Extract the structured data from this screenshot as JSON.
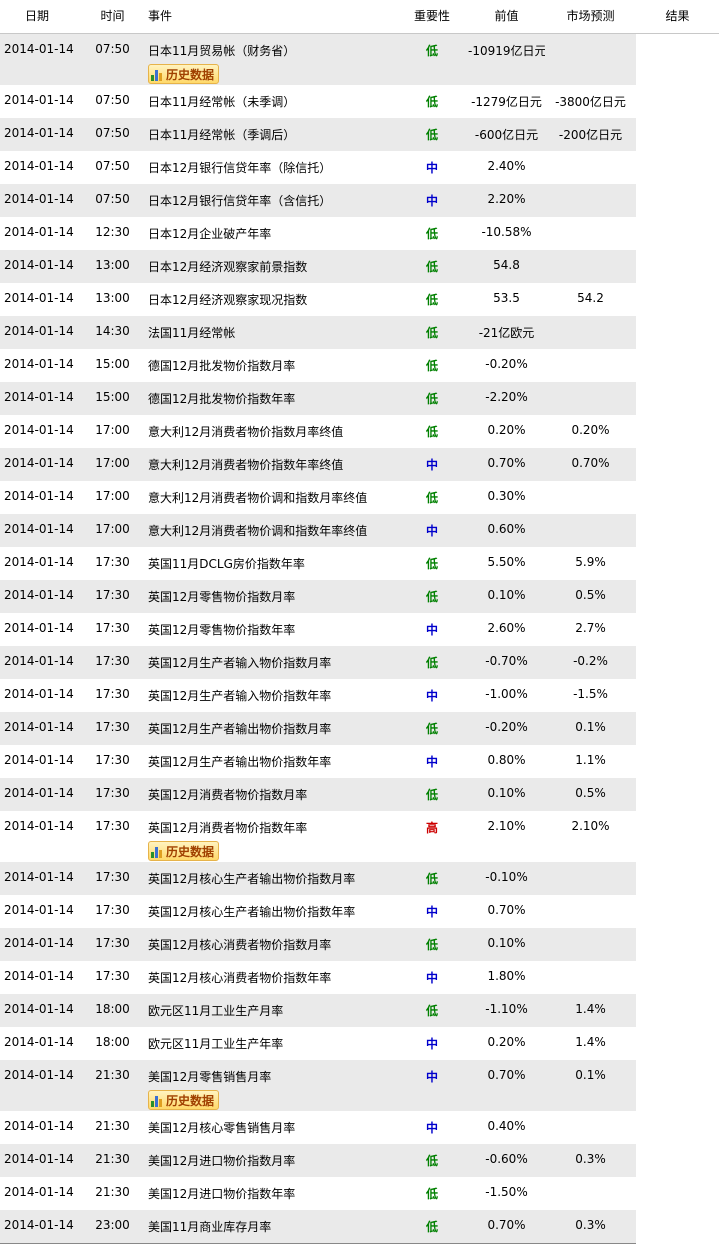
{
  "headers": {
    "date": "日期",
    "time": "时间",
    "event": "事件",
    "importance": "重要性",
    "previous": "前值",
    "forecast": "市场预测",
    "result": "结果"
  },
  "history_label": "历史数据",
  "rows": [
    {
      "date": "2014-01-14",
      "time": "07:50",
      "event": "日本11月贸易帐（财务省）",
      "importance": "低",
      "level": "low",
      "previous": "-10919亿日元",
      "forecast": "",
      "result": "",
      "history": true
    },
    {
      "date": "2014-01-14",
      "time": "07:50",
      "event": "日本11月经常帐（未季调）",
      "importance": "低",
      "level": "low",
      "previous": "-1279亿日元",
      "forecast": "-3800亿日元",
      "result": "",
      "history": false
    },
    {
      "date": "2014-01-14",
      "time": "07:50",
      "event": "日本11月经常帐（季调后）",
      "importance": "低",
      "level": "low",
      "previous": "-600亿日元",
      "forecast": "-200亿日元",
      "result": "",
      "history": false
    },
    {
      "date": "2014-01-14",
      "time": "07:50",
      "event": "日本12月银行信贷年率（除信托）",
      "importance": "中",
      "level": "mid",
      "previous": "2.40%",
      "forecast": "",
      "result": "",
      "history": false
    },
    {
      "date": "2014-01-14",
      "time": "07:50",
      "event": "日本12月银行信贷年率（含信托）",
      "importance": "中",
      "level": "mid",
      "previous": "2.20%",
      "forecast": "",
      "result": "",
      "history": false
    },
    {
      "date": "2014-01-14",
      "time": "12:30",
      "event": "日本12月企业破产年率",
      "importance": "低",
      "level": "low",
      "previous": "-10.58%",
      "forecast": "",
      "result": "",
      "history": false
    },
    {
      "date": "2014-01-14",
      "time": "13:00",
      "event": "日本12月经济观察家前景指数",
      "importance": "低",
      "level": "low",
      "previous": "54.8",
      "forecast": "",
      "result": "",
      "history": false
    },
    {
      "date": "2014-01-14",
      "time": "13:00",
      "event": "日本12月经济观察家现况指数",
      "importance": "低",
      "level": "low",
      "previous": "53.5",
      "forecast": "54.2",
      "result": "",
      "history": false
    },
    {
      "date": "2014-01-14",
      "time": "14:30",
      "event": "法国11月经常帐",
      "importance": "低",
      "level": "low",
      "previous": "-21亿欧元",
      "forecast": "",
      "result": "",
      "history": false
    },
    {
      "date": "2014-01-14",
      "time": "15:00",
      "event": "德国12月批发物价指数月率",
      "importance": "低",
      "level": "low",
      "previous": "-0.20%",
      "forecast": "",
      "result": "",
      "history": false
    },
    {
      "date": "2014-01-14",
      "time": "15:00",
      "event": "德国12月批发物价指数年率",
      "importance": "低",
      "level": "low",
      "previous": "-2.20%",
      "forecast": "",
      "result": "",
      "history": false
    },
    {
      "date": "2014-01-14",
      "time": "17:00",
      "event": "意大利12月消费者物价指数月率终值",
      "importance": "低",
      "level": "low",
      "previous": "0.20%",
      "forecast": "0.20%",
      "result": "",
      "history": false
    },
    {
      "date": "2014-01-14",
      "time": "17:00",
      "event": "意大利12月消费者物价指数年率终值",
      "importance": "中",
      "level": "mid",
      "previous": "0.70%",
      "forecast": "0.70%",
      "result": "",
      "history": false
    },
    {
      "date": "2014-01-14",
      "time": "17:00",
      "event": "意大利12月消费者物价调和指数月率终值",
      "importance": "低",
      "level": "low",
      "previous": "0.30%",
      "forecast": "",
      "result": "",
      "history": false
    },
    {
      "date": "2014-01-14",
      "time": "17:00",
      "event": "意大利12月消费者物价调和指数年率终值",
      "importance": "中",
      "level": "mid",
      "previous": "0.60%",
      "forecast": "",
      "result": "",
      "history": false
    },
    {
      "date": "2014-01-14",
      "time": "17:30",
      "event": "英国11月DCLG房价指数年率",
      "importance": "低",
      "level": "low",
      "previous": "5.50%",
      "forecast": "5.9%",
      "result": "",
      "history": false
    },
    {
      "date": "2014-01-14",
      "time": "17:30",
      "event": "英国12月零售物价指数月率",
      "importance": "低",
      "level": "low",
      "previous": "0.10%",
      "forecast": "0.5%",
      "result": "",
      "history": false
    },
    {
      "date": "2014-01-14",
      "time": "17:30",
      "event": "英国12月零售物价指数年率",
      "importance": "中",
      "level": "mid",
      "previous": "2.60%",
      "forecast": "2.7%",
      "result": "",
      "history": false
    },
    {
      "date": "2014-01-14",
      "time": "17:30",
      "event": "英国12月生产者输入物价指数月率",
      "importance": "低",
      "level": "low",
      "previous": "-0.70%",
      "forecast": "-0.2%",
      "result": "",
      "history": false
    },
    {
      "date": "2014-01-14",
      "time": "17:30",
      "event": "英国12月生产者输入物价指数年率",
      "importance": "中",
      "level": "mid",
      "previous": "-1.00%",
      "forecast": "-1.5%",
      "result": "",
      "history": false
    },
    {
      "date": "2014-01-14",
      "time": "17:30",
      "event": "英国12月生产者输出物价指数月率",
      "importance": "低",
      "level": "low",
      "previous": "-0.20%",
      "forecast": "0.1%",
      "result": "",
      "history": false
    },
    {
      "date": "2014-01-14",
      "time": "17:30",
      "event": "英国12月生产者输出物价指数年率",
      "importance": "中",
      "level": "mid",
      "previous": "0.80%",
      "forecast": "1.1%",
      "result": "",
      "history": false
    },
    {
      "date": "2014-01-14",
      "time": "17:30",
      "event": "英国12月消费者物价指数月率",
      "importance": "低",
      "level": "low",
      "previous": "0.10%",
      "forecast": "0.5%",
      "result": "",
      "history": false
    },
    {
      "date": "2014-01-14",
      "time": "17:30",
      "event": "英国12月消费者物价指数年率",
      "importance": "高",
      "level": "high",
      "previous": "2.10%",
      "forecast": "2.10%",
      "result": "",
      "history": true
    },
    {
      "date": "2014-01-14",
      "time": "17:30",
      "event": "英国12月核心生产者输出物价指数月率",
      "importance": "低",
      "level": "low",
      "previous": "-0.10%",
      "forecast": "",
      "result": "",
      "history": false
    },
    {
      "date": "2014-01-14",
      "time": "17:30",
      "event": "英国12月核心生产者输出物价指数年率",
      "importance": "中",
      "level": "mid",
      "previous": "0.70%",
      "forecast": "",
      "result": "",
      "history": false
    },
    {
      "date": "2014-01-14",
      "time": "17:30",
      "event": "英国12月核心消费者物价指数月率",
      "importance": "低",
      "level": "low",
      "previous": "0.10%",
      "forecast": "",
      "result": "",
      "history": false
    },
    {
      "date": "2014-01-14",
      "time": "17:30",
      "event": "英国12月核心消费者物价指数年率",
      "importance": "中",
      "level": "mid",
      "previous": "1.80%",
      "forecast": "",
      "result": "",
      "history": false
    },
    {
      "date": "2014-01-14",
      "time": "18:00",
      "event": "欧元区11月工业生产月率",
      "importance": "低",
      "level": "low",
      "previous": "-1.10%",
      "forecast": "1.4%",
      "result": "",
      "history": false
    },
    {
      "date": "2014-01-14",
      "time": "18:00",
      "event": "欧元区11月工业生产年率",
      "importance": "中",
      "level": "mid",
      "previous": "0.20%",
      "forecast": "1.4%",
      "result": "",
      "history": false
    },
    {
      "date": "2014-01-14",
      "time": "21:30",
      "event": "美国12月零售销售月率",
      "importance": "中",
      "level": "mid",
      "previous": "0.70%",
      "forecast": "0.1%",
      "result": "",
      "history": true
    },
    {
      "date": "2014-01-14",
      "time": "21:30",
      "event": "美国12月核心零售销售月率",
      "importance": "中",
      "level": "mid",
      "previous": "0.40%",
      "forecast": "",
      "result": "",
      "history": false
    },
    {
      "date": "2014-01-14",
      "time": "21:30",
      "event": "美国12月进口物价指数月率",
      "importance": "低",
      "level": "low",
      "previous": "-0.60%",
      "forecast": "0.3%",
      "result": "",
      "history": false
    },
    {
      "date": "2014-01-14",
      "time": "21:30",
      "event": "美国12月进口物价指数年率",
      "importance": "低",
      "level": "low",
      "previous": "-1.50%",
      "forecast": "",
      "result": "",
      "history": false
    },
    {
      "date": "2014-01-14",
      "time": "23:00",
      "event": "美国11月商业库存月率",
      "importance": "低",
      "level": "low",
      "previous": "0.70%",
      "forecast": "0.3%",
      "result": "",
      "history": false
    }
  ]
}
